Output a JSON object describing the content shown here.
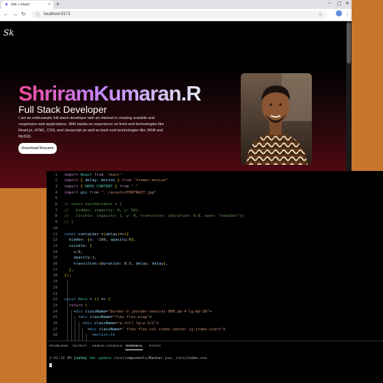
{
  "browser": {
    "tab_title": "Vite + React",
    "url": "localhost:5173",
    "icons": {
      "back": "back-arrow-icon",
      "forward": "forward-arrow-icon",
      "reload": "reload-icon",
      "star": "star-icon",
      "menu": "kebab-menu-icon"
    }
  },
  "site": {
    "logo": "Sk",
    "name": "ShriramKumaran.R",
    "role": "Full Stack Developer",
    "description": "I am an enthusiastic full-stack developer with an interest in creating scalable and responsive web applications. With hands-on experience on front-end technologies like React.js, HTML, CSS, and Javascript as well as back-end technologies like JAVA and MySQL.",
    "button": "Download Resume"
  },
  "editor": {
    "lines": [
      {
        "n": "1",
        "t": "import React from 'react'"
      },
      {
        "n": "2",
        "t": "import { delay, motion } from \"framer-motion\""
      },
      {
        "n": "3",
        "t": "import { HERO_CONTENT } from \".\""
      },
      {
        "n": "4",
        "t": "import pic from \"../assets/PORTRAIT.jpg\""
      },
      {
        "n": "5",
        "t": ""
      },
      {
        "n": "6",
        "t": "// const textVariants = {"
      },
      {
        "n": "7",
        "t": "//   hidden: {opacity: 0, y: 50},"
      },
      {
        "n": "8",
        "t": "//   visible: {opacity: 1, y: 0, transition: {duration: 0.8, ease: \"easeOut\"}}"
      },
      {
        "n": "9",
        "t": "// }"
      },
      {
        "n": "10",
        "t": ""
      },
      {
        "n": "11",
        "t": "const container =(delay)=>({"
      },
      {
        "n": "12",
        "t": "  hidden: {x: -100, opacity:0},"
      },
      {
        "n": "13",
        "t": "  visible: {"
      },
      {
        "n": "14",
        "t": "    x:0,"
      },
      {
        "n": "15",
        "t": "    opacity:1,"
      },
      {
        "n": "16",
        "t": "    transition:{duration: 0.5, delay: delay},"
      },
      {
        "n": "17",
        "t": "  },"
      },
      {
        "n": "18",
        "t": "});"
      },
      {
        "n": "19",
        "t": ""
      },
      {
        "n": "20",
        "t": ""
      },
      {
        "n": "21",
        "t": ""
      },
      {
        "n": "22",
        "t": "const Hero = () => {"
      },
      {
        "n": "23",
        "t": "  return ("
      },
      {
        "n": "24",
        "t": "    <div className=\"border-b ▢border-neutral-900 pb-4 lg:mb-36\">"
      },
      {
        "n": "25",
        "t": "      <div className=\"flex flex-wrap\">"
      },
      {
        "n": "26",
        "t": "        <div className=\"w-full lg:w-1/2\">"
      },
      {
        "n": "27",
        "t": "          <div className=\" flex flex-col items-center lg:items-start\">"
      },
      {
        "n": "28",
        "t": "            <motion.h1"
      }
    ]
  },
  "panel": {
    "tabs": [
      "PROBLEMS",
      "OUTPUT",
      "DEBUG CONSOLE",
      "TERMINAL",
      "PORTS"
    ],
    "active_tab": "TERMINAL",
    "terminal": {
      "time": "2:41:32 AM",
      "tag": "[vite]",
      "event": "hmr update",
      "paths": "/src/components/Navbar.jsx, /src/index.css"
    }
  },
  "colors": {
    "background": "#c8762c",
    "name_gradient_start": "#ec4899",
    "name_gradient_mid": "#c084fc",
    "keyword": "#569cd6",
    "string": "#ce9178",
    "comment": "#6a9955"
  }
}
